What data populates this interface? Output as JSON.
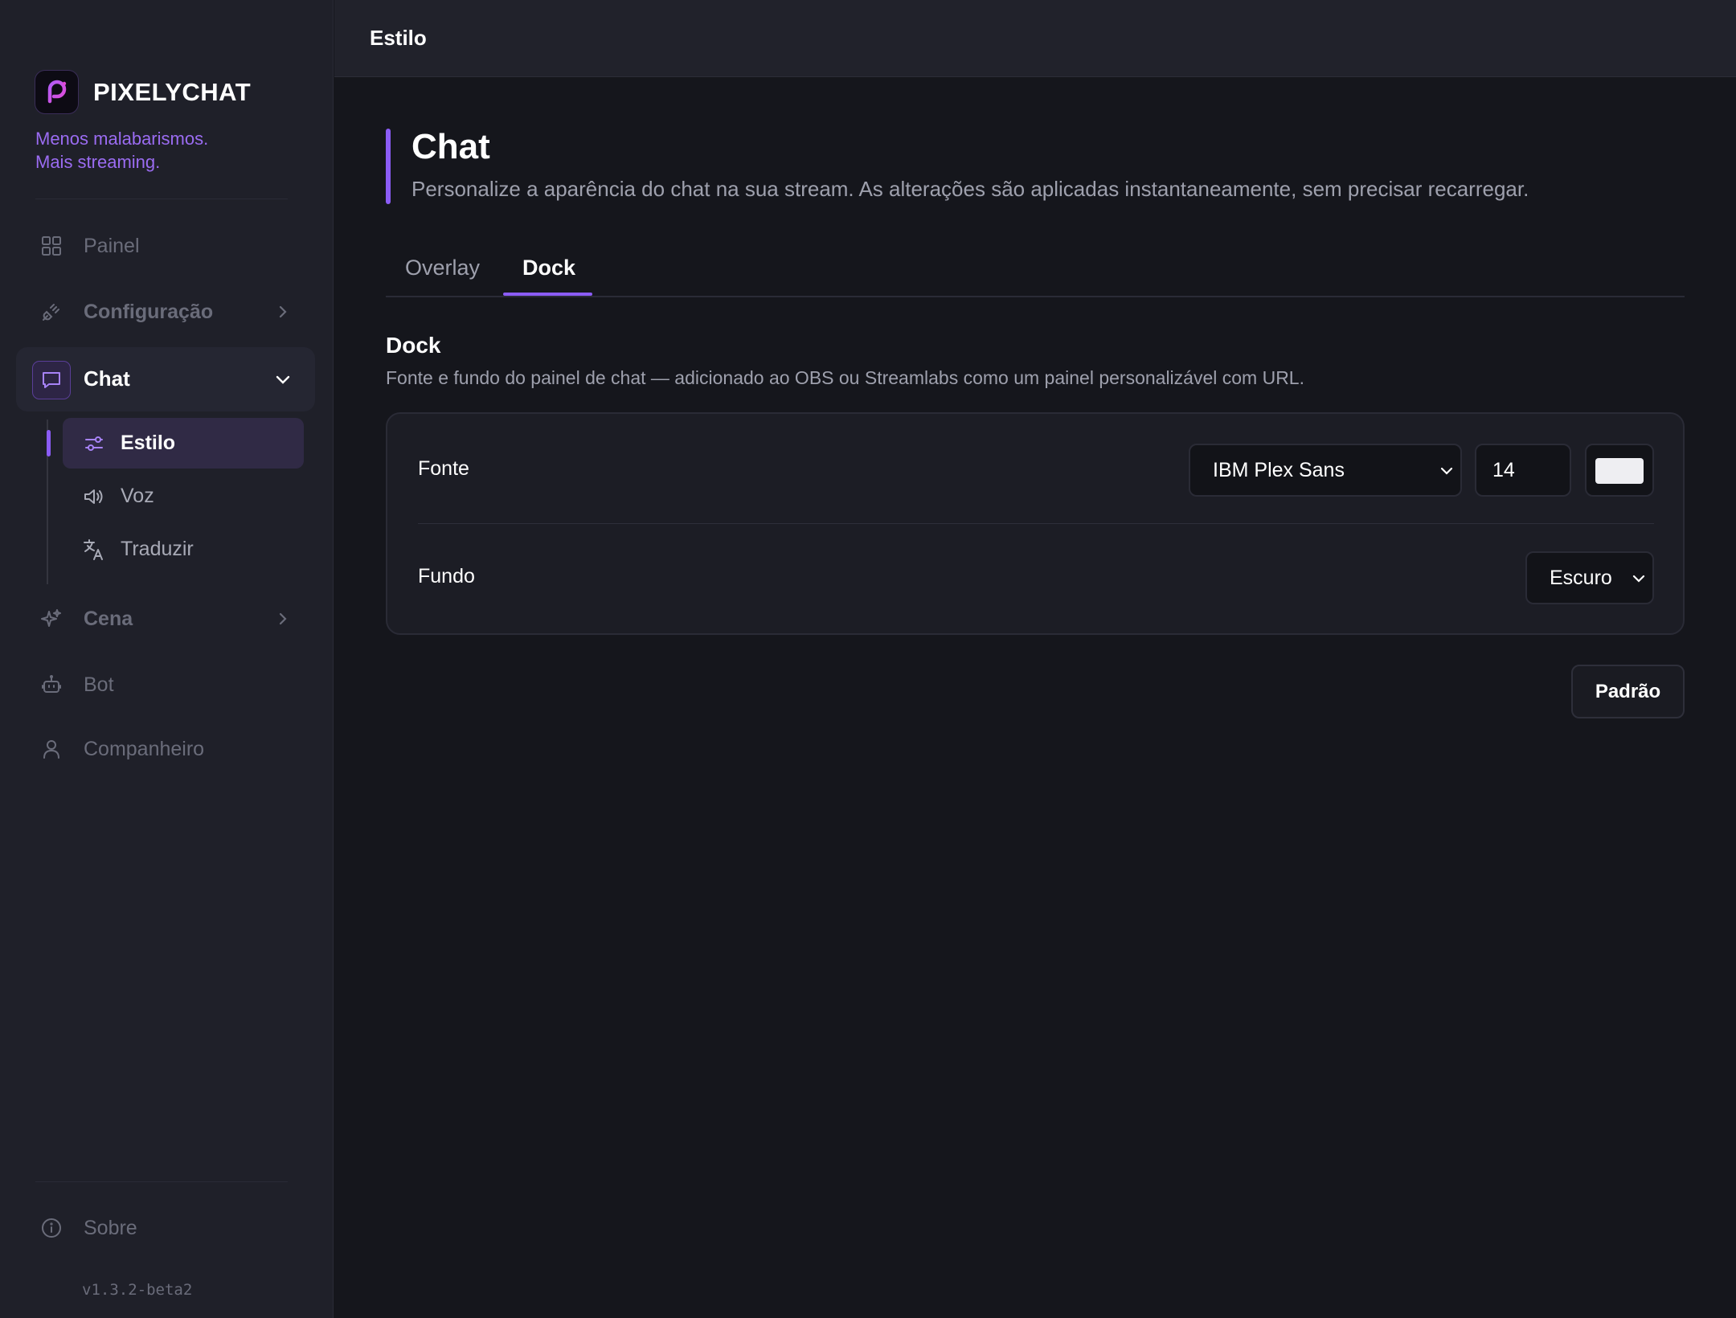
{
  "app": {
    "name": "PIXELYCHAT",
    "tagline_line1": "Menos malabarismos.",
    "tagline_line2": "Mais streaming.",
    "version": "v1.3.2-beta2",
    "accent_color": "#8b5cf6"
  },
  "sidebar": {
    "items": [
      {
        "label": "Painel",
        "icon": "grid-icon"
      },
      {
        "label": "Configuração",
        "icon": "plug-icon"
      },
      {
        "label": "Chat",
        "icon": "chat-bubble-icon"
      },
      {
        "label": "Cena",
        "icon": "sparkles-icon"
      },
      {
        "label": "Bot",
        "icon": "robot-icon"
      },
      {
        "label": "Companheiro",
        "icon": "user-icon"
      }
    ],
    "chat_subitems": [
      {
        "label": "Estilo",
        "icon": "sliders-icon"
      },
      {
        "label": "Voz",
        "icon": "speaker-icon"
      },
      {
        "label": "Traduzir",
        "icon": "translate-icon"
      }
    ],
    "footer": {
      "label": "Sobre",
      "icon": "info-icon"
    }
  },
  "header": {
    "title": "Estilo"
  },
  "page": {
    "title": "Chat",
    "subtitle": "Personalize a aparência do chat na sua stream. As alterações são aplicadas instantaneamente, sem precisar recarregar."
  },
  "tabs": [
    {
      "label": "Overlay",
      "active": false
    },
    {
      "label": "Dock",
      "active": true
    }
  ],
  "section": {
    "title": "Dock",
    "subtitle": "Fonte e fundo do painel de chat — adicionado ao OBS ou Streamlabs como um painel personalizável com URL."
  },
  "settings": {
    "font": {
      "label": "Fonte",
      "family": "IBM Plex Sans",
      "size": "14",
      "color": "#eeeef2"
    },
    "background": {
      "label": "Fundo",
      "value": "Escuro"
    }
  },
  "actions": {
    "default_label": "Padrão"
  }
}
